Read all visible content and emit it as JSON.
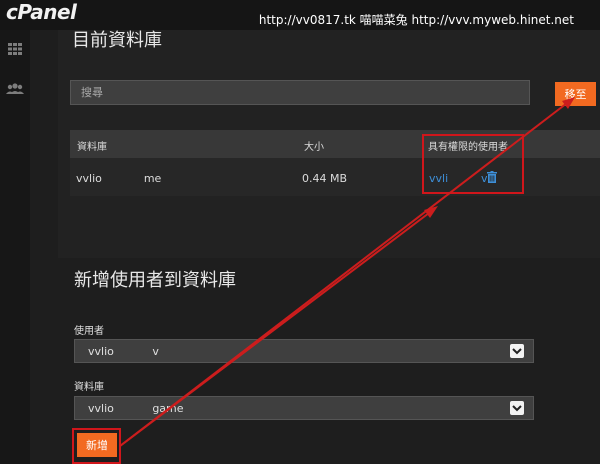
{
  "app": {
    "logo": "cPanel"
  },
  "watermark": "http://vv0817.tk 喵喵菜兔 http://vvv.myweb.hinet.net",
  "sidebar": {
    "items": [
      {
        "icon": "grid-icon"
      },
      {
        "icon": "users-icon"
      }
    ]
  },
  "databases_panel": {
    "title": "目前資料庫",
    "search_placeholder": "搜尋",
    "move_button": "移至",
    "columns": {
      "database": "資料庫",
      "size": "大小",
      "privileged_users": "具有權限的使用者"
    },
    "rows": [
      {
        "database": "vvlio            me",
        "size": "0.44 MB",
        "user_part1": "vvli",
        "user_part2": "v"
      }
    ]
  },
  "add_user_panel": {
    "title": "新增使用者到資料庫",
    "user_label": "使用者",
    "user_value": "vvlio           v",
    "db_label": "資料庫",
    "db_value": "vvlio           game",
    "add_button": "新增"
  },
  "colors": {
    "accent": "#f26a21",
    "highlight": "#d0161b",
    "link": "#3d8fd8"
  }
}
